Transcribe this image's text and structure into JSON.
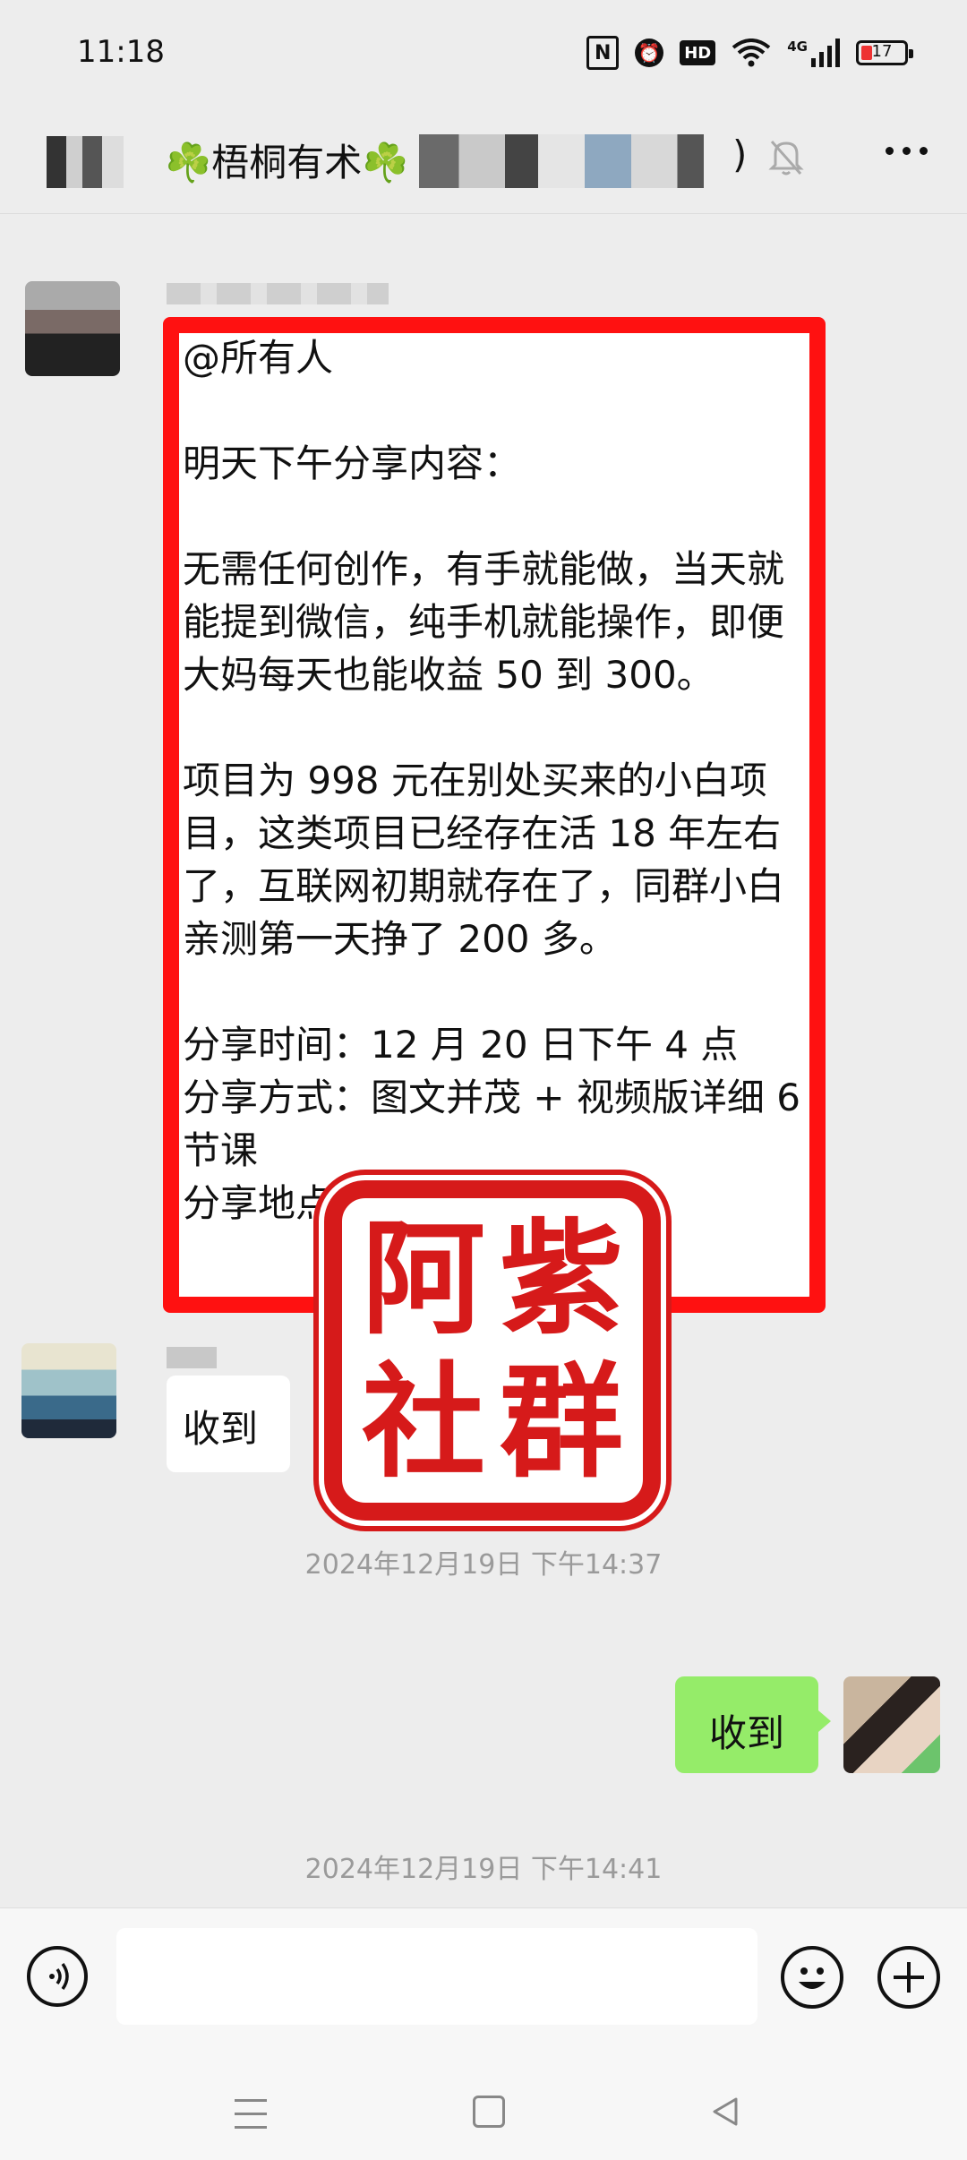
{
  "status_bar": {
    "time": "11:18",
    "signal_label": "4G",
    "battery": "17"
  },
  "header": {
    "title": "☘️梧桐有术☘️",
    "title_suffix": ")"
  },
  "chat": {
    "announcement": "@所有人\n\n明天下午分享内容：\n\n无需任何创作，有手就能做，当天就能提到微信，纯手机就能操作，即便大妈每天也能收益 50 到 300。\n\n项目为 998 元在别处买来的小白项目，这类项目已经存在活 18 年左右了，互联网初期就存在了，同群小白亲测第一天挣了 200 多。\n\n分享时间：12 月 20 日下午 4 点\n分享方式：图文并茂 + 视频版详细 6 节课\n分享地点",
    "reply_text": "收到",
    "timestamp_1": "2024年12月19日 下午14:37",
    "my_reply": "收到",
    "timestamp_2": "2024年12月19日 下午14:41"
  },
  "watermark": {
    "chars": [
      "阿",
      "紫",
      "社",
      "群"
    ],
    "color": "#d61a1a"
  },
  "colors": {
    "highlight_frame": "#ff1111",
    "my_bubble": "#95ec69",
    "background": "#ededed"
  },
  "icons": [
    "nfc-icon",
    "alarm-icon",
    "hd-icon",
    "wifi-icon",
    "signal-icon",
    "battery-icon",
    "mute-icon",
    "more-icon",
    "voice-icon",
    "emoji-icon",
    "plus-icon",
    "menu-icon",
    "home-icon",
    "back-icon"
  ]
}
